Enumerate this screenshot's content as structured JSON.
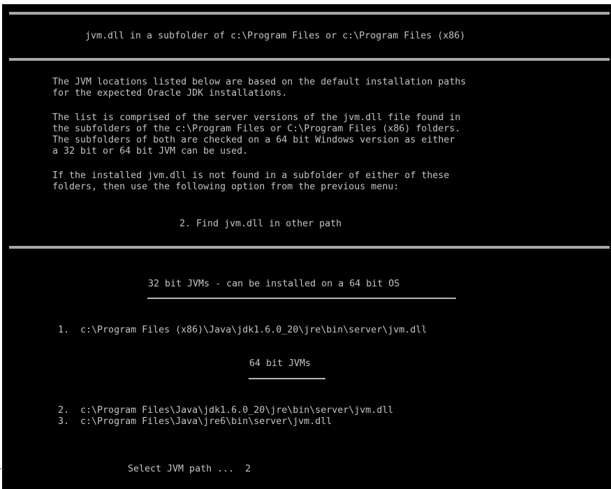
{
  "header": {
    "title": "jvm.dll in a subfolder of c:\\Program Files or c:\\Program Files (x86)"
  },
  "info": {
    "para1": [
      "The JVM locations listed below are based on the default installation paths",
      "for the expected Oracle JDK installations."
    ],
    "para2": [
      "The list is comprised of the server versions of the jvm.dll file found in",
      "the subfolders of the c:\\Program Files or C:\\Program Files (x86) folders.",
      "The subfolders of both are checked on a 64 bit Windows version as either",
      "a 32 bit or 64 bit JVM can be used."
    ],
    "para3": [
      "If the installed jvm.dll is not found in a subfolder of either of these",
      "folders, then use the following option from the previous menu:"
    ],
    "option": "2. Find jvm.dll in other path"
  },
  "jvm_list": {
    "section_32_heading": "32 bit JVMs - can be installed on a 64 bit OS",
    "items_32": [
      {
        "number": "1.",
        "path": "c:\\Program Files (x86)\\Java\\jdk1.6.0_20\\jre\\bin\\server\\jvm.dll"
      }
    ],
    "section_64_heading": "64 bit JVMs",
    "items_64": [
      {
        "number": "2.",
        "path": "c:\\Program Files\\Java\\jdk1.6.0_20\\jre\\bin\\server\\jvm.dll"
      },
      {
        "number": "3.",
        "path": "c:\\Program Files\\Java\\jre6\\bin\\server\\jvm.dll"
      }
    ]
  },
  "prompt": {
    "label": "Select JVM path ...",
    "value": "2"
  },
  "colors": {
    "background": "#000000",
    "text": "#c4c4c4",
    "rule": "#a8a8a8"
  }
}
